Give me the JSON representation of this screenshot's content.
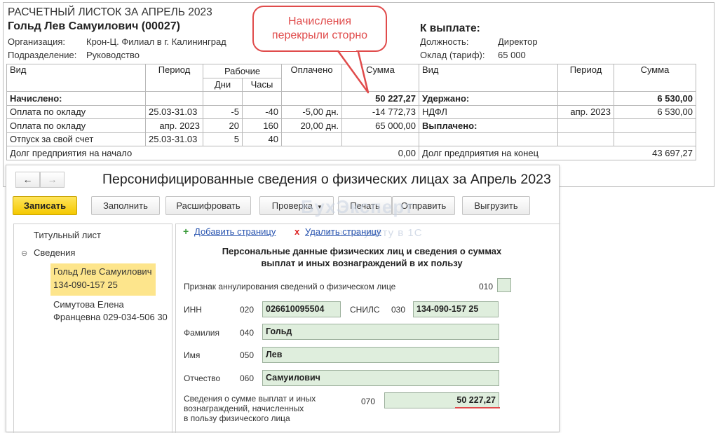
{
  "payslip": {
    "title": "РАСЧЕТНЫЙ ЛИСТОК ЗА АПРЕЛЬ 2023",
    "employee": "Гольд Лев Самуилович (00027)",
    "org_label": "Организация:",
    "org_value": "Крон-Ц. Филиал в г. Калининград",
    "dept_label": "Подразделение:",
    "dept_value": "Руководство",
    "to_pay_label": "К выплате:",
    "position_label": "Должность:",
    "position_value": "Директор",
    "salary_label": "Оклад (тариф):",
    "salary_value": "65 000",
    "headers": {
      "vid": "Вид",
      "period": "Период",
      "working": "Рабочие",
      "paid": "Оплачено",
      "sum": "Сумма",
      "days": "Дни",
      "hours": "Часы",
      "vid2": "Вид",
      "period2": "Период",
      "sum2": "Сумма"
    },
    "accrued_label": "Начислено:",
    "accrued_total": "50 227,27",
    "withheld_label": "Удержано:",
    "withheld_total": "6 530,00",
    "rows": [
      {
        "vid": "Оплата по окладу",
        "period": "25.03-31.03",
        "days": "-5",
        "hours": "-40",
        "paid": "-5,00 дн.",
        "sum": "-14 772,73",
        "vid2": "НДФЛ",
        "period2": "апр. 2023",
        "sum2": "6 530,00"
      },
      {
        "vid": "Оплата по окладу",
        "period": "апр. 2023",
        "days": "20",
        "hours": "160",
        "paid": "20,00 дн.",
        "sum": "65 000,00",
        "vid2": "Выплачено:",
        "period2": "",
        "sum2": ""
      },
      {
        "vid": "Отпуск за свой счет",
        "period": "25.03-31.03",
        "days": "5",
        "hours": "40",
        "paid": "",
        "sum": "",
        "vid2": "",
        "period2": "",
        "sum2": ""
      }
    ],
    "debt_start_label": "Долг предприятия на начало",
    "debt_start_value": "0,00",
    "debt_end_label": "Долг предприятия на конец",
    "debt_end_value": "43 697,27"
  },
  "callout": {
    "line1": "Начисления",
    "line2": "перекрыли сторно"
  },
  "form": {
    "title": "Персонифицированные сведения о физических лицах за Апрель 2023",
    "back_icon": "arrow-left-icon",
    "forward_icon": "arrow-right-icon",
    "toolbar": {
      "save": "Записать",
      "fill": "Заполнить",
      "decode": "Расшифровать",
      "check": "Проверка",
      "print": "Печать",
      "send": "Отправить",
      "export": "Выгрузить"
    },
    "tree": {
      "title_page": "Титульный лист",
      "info": "Сведения",
      "person1_name": "Гольд Лев Самуилович",
      "person1_snils": "134-090-157 25",
      "person2_name": "Симутова Елена",
      "person2_line2": "Францевна 029-034-506 30"
    },
    "add_page": "Добавить страницу",
    "del_page": "Удалить страницу",
    "section_title_1": "Персональные данные физических лиц и сведения о суммах",
    "section_title_2": "выплат и иных вознаграждений в их пользу",
    "annul_label": "Признак аннулирования сведений о физическом лице",
    "annul_code": "010",
    "inn_label": "ИНН",
    "inn_code": "020",
    "inn_value": "026610095504",
    "snils_label": "СНИЛС",
    "snils_code": "030",
    "snils_value": "134-090-157 25",
    "surname_label": "Фамилия",
    "surname_code": "040",
    "surname_value": "Гольд",
    "name_label": "Имя",
    "name_code": "050",
    "name_value": "Лев",
    "patronymic_label": "Отчество",
    "patronymic_code": "060",
    "patronymic_value": "Самуилович",
    "sum_label_1": "Сведения о сумме выплат и иных",
    "sum_label_2": "вознаграждений, начисленных",
    "sum_label_3": "в пользу физического лица",
    "sum_code": "070",
    "sum_value": "50 227,27"
  },
  "watermark": {
    "line1": "БухЭксперт",
    "line2": "в    в    по учёту в 1С"
  },
  "colors": {
    "accent_red": "#e04b4b",
    "save_yellow": "#f4c800",
    "field_green": "#dfeedd",
    "selection": "#fde58c"
  }
}
